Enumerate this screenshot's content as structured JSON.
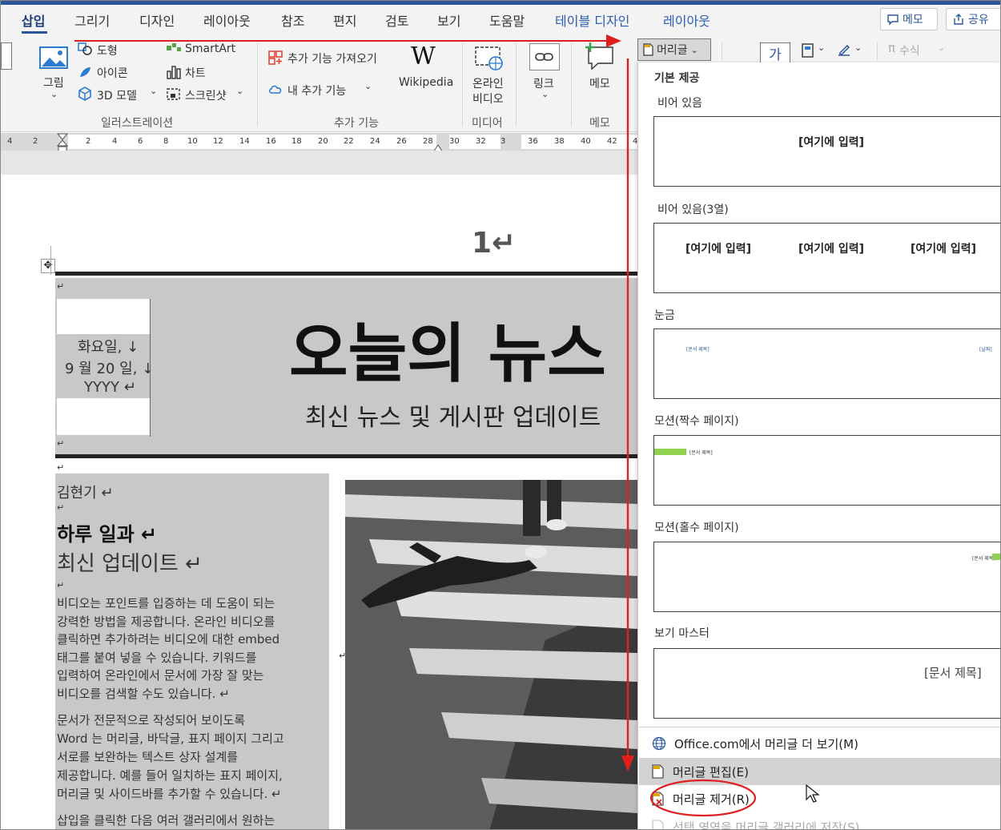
{
  "tabs": {
    "insert": "삽입",
    "draw": "그리기",
    "design": "디자인",
    "layout": "레이아웃",
    "references": "참조",
    "mailings": "편지",
    "review": "검토",
    "view": "보기",
    "help": "도움말",
    "table_design": "테이블 디자인",
    "table_layout": "레이아웃"
  },
  "top_buttons": {
    "memo": "메모",
    "share": "공유"
  },
  "ribbon": {
    "picture": "그림",
    "shapes": "도형",
    "icons": "아이콘",
    "model3d": "3D 모델",
    "smartart": "SmartArt",
    "chart": "차트",
    "screenshot": "스크린샷",
    "illustrations_group": "일러스트레이션",
    "get_addins": "추가 기능 가져오기",
    "my_addins": "내 추가 기능",
    "wikipedia": "Wikipedia",
    "addins_group": "추가 기능",
    "online_video_1": "온라인",
    "online_video_2": "비디오",
    "media_group": "미디어",
    "link": "링크",
    "comment": "메모",
    "comment_group": "메모",
    "header_button": "머리글",
    "equation": "수식",
    "textbox_glyph": "가"
  },
  "ruler": {
    "ticks": [
      "4",
      "2",
      "2",
      "4",
      "6",
      "8",
      "10",
      "12",
      "14",
      "16",
      "18",
      "20",
      "22",
      "24",
      "26",
      "28",
      "30",
      "32",
      "3",
      "36",
      "38",
      "40",
      "42",
      "4"
    ]
  },
  "document": {
    "page_number": "1↵",
    "title": "오늘의 뉴스",
    "subtitle": "최신 뉴스 및 게시판 업데이트",
    "date_line1": "화요일, ↓",
    "date_line2": "9 월 20 일, ↓",
    "date_line3": "YYYY ↵",
    "author": "김현기 ↵",
    "heading": "하루 일과 ↵",
    "subheading": "최신 업데이트 ↵",
    "para1": [
      "비디오는 포인트를 입증하는 데 도움이 되는",
      "강력한 방법을 제공합니다. 온라인 비디오를",
      "클릭하면 추가하려는 비디오에 대한 embed",
      "태그를 붙여 넣을 수 있습니다. 키워드를",
      "입력하여 온라인에서 문서에 가장 잘 맞는",
      "비디오를 검색할 수도 있습니다. ↵"
    ],
    "para2": [
      "문서가 전문적으로 작성되어 보이도록",
      "Word 는 머리글, 바닥글, 표지 페이지 그리고",
      "서로를 보완하는 텍스트 상자 설계를",
      "제공합니다. 예를 들어 일치하는 표지 페이지,",
      "머리글 및 사이드바를 추가할 수 있습니다. ↵"
    ],
    "para3": "삽입을 클릭한 다음 여러 갤러리에서 원하는",
    "para_mark": "↵"
  },
  "dropdown": {
    "builtin": "기본 제공",
    "blank": "비어 있음",
    "blank_3col": "비어 있음(3열)",
    "grid": "눈금",
    "motion_even": "모션(짝수 페이지)",
    "motion_odd": "모션(홀수 페이지)",
    "view_master": "보기 마스터",
    "placeholder": "[여기에 입력]",
    "doc_title": "[문서 제목]",
    "tiny_title": "[문서 제목]",
    "tiny_date": "[날짜]",
    "tiny_doc": "[문서 제목]",
    "tiny_odd": "[문서 제목]",
    "more_online": "Office.com에서 머리글 더 보기(M)",
    "edit_header": "머리글 편집(E)",
    "remove_header": "머리글 제거(R)",
    "save_selection": "선택 영역을 머리글 갤러리에 저장(S)..."
  },
  "colors": {
    "accent": "#2b579a",
    "annotation_red": "#e02020",
    "motion_green": "#92d050"
  }
}
